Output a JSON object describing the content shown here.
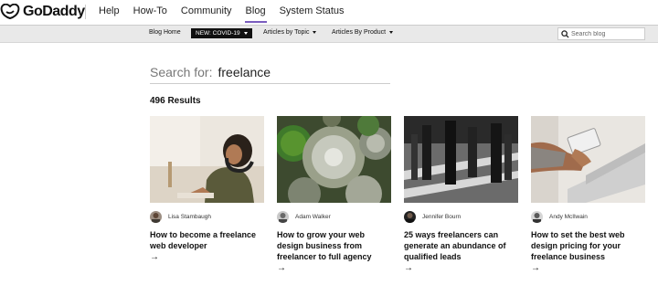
{
  "brand": {
    "name": "GoDaddy"
  },
  "topnav": [
    "Help",
    "How-To",
    "Community",
    "Blog",
    "System Status"
  ],
  "topnav_active": "Blog",
  "subnav": {
    "home": "Blog Home",
    "covid": "NEW: COVID-19",
    "topic": "Articles by Topic",
    "product": "Articles By Product",
    "search_placeholder": "Search blog"
  },
  "search": {
    "label": "Search for:",
    "term": "freelance"
  },
  "results_count": "496 Results",
  "cards": [
    {
      "author": "Lisa Stambaugh",
      "title": "How to become a freelance web developer",
      "arrow": "→"
    },
    {
      "author": "Adam Walker",
      "title": "How to grow your web design business from freelancer to full agency",
      "arrow": "→"
    },
    {
      "author": "Jennifer Bourn",
      "title": "25 ways freelancers can generate an abundance of qualified leads",
      "arrow": "→"
    },
    {
      "author": "Andy McIlwain",
      "title": "How to set the best web design pricing for your freelance business",
      "arrow": "→"
    }
  ],
  "colors": {
    "accent": "#7a5dbf",
    "covid_bg": "#111111",
    "subbar_bg": "#e9e9e9"
  }
}
